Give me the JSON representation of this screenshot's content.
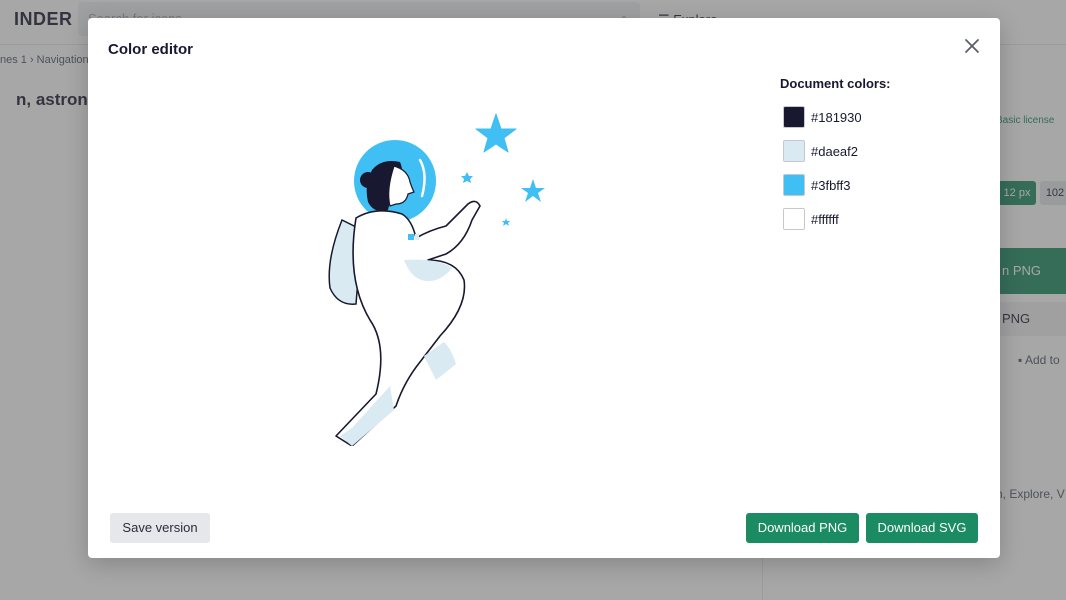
{
  "background": {
    "logo": "INDER",
    "search_placeholder": "Search for icons",
    "explore": "☰ Explore",
    "breadcrumb": "nes 1 › Navigation",
    "title": "n, astronau",
    "license": "Basic license",
    "size_badge": "12 px",
    "size_badge2": "102",
    "download_png_partial": "n PNG",
    "png_partial": "PNG",
    "add_partial": "Add to",
    "tags": "n, Explore, V"
  },
  "modal": {
    "title": "Color editor",
    "colors_heading": "Document colors:",
    "colors": [
      {
        "hex": "#181930"
      },
      {
        "hex": "#daeaf2"
      },
      {
        "hex": "#3fbff3"
      },
      {
        "hex": "#ffffff"
      }
    ],
    "buttons": {
      "save": "Save version",
      "download_png": "Download PNG",
      "download_svg": "Download SVG"
    }
  },
  "icons": {
    "close": "close-icon",
    "search": "search-icon",
    "illustration": "astronaut-illustration"
  },
  "theme": {
    "accent": "#1a8b63",
    "dark": "#181930",
    "light_blue": "#daeaf2",
    "blue": "#3fbff3"
  }
}
